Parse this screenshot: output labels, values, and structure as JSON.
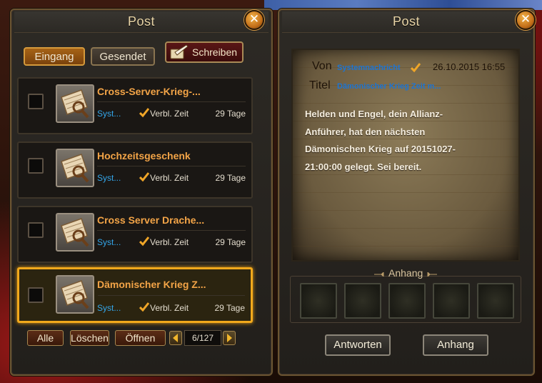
{
  "left_panel": {
    "title": "Post",
    "tabs": [
      {
        "label": "Eingang",
        "active": true
      },
      {
        "label": "Gesendet",
        "active": false
      }
    ],
    "write_button": "Schreiben",
    "mails": [
      {
        "subject": "Cross-Server-Krieg-...",
        "sender": "Syst...",
        "time_label": "Verbl. Zeit",
        "days": "29 Tage",
        "selected": false
      },
      {
        "subject": "Hochzeitsgeschenk",
        "sender": "Syst...",
        "time_label": "Verbl. Zeit",
        "days": "29 Tage",
        "selected": false
      },
      {
        "subject": "Cross Server Drache...",
        "sender": "Syst...",
        "time_label": "Verbl. Zeit",
        "days": "29 Tage",
        "selected": false
      },
      {
        "subject": "Dämonischer Krieg Z...",
        "sender": "Syst...",
        "time_label": "Verbl. Zeit",
        "days": "29 Tage",
        "selected": true
      }
    ],
    "footer": {
      "all_button": "Alle",
      "delete_button": "Löschen",
      "open_button": "Öffnen",
      "page": "6/127"
    }
  },
  "right_panel": {
    "title": "Post",
    "from_label": "Von",
    "from_value": "Systemnachricht",
    "date": "26.10.2015 16:55",
    "title_label": "Titel",
    "title_value": "Dämonischer Krieg Zeit m...",
    "body_lines": [
      "Helden und Engel, dein Allianz-",
      "Anführer, hat den nächsten",
      "Dämonischen Krieg auf 20151027-",
      "21:00:00 gelegt. Sei bereit."
    ],
    "attachment_title": "Anhang",
    "attachment_slots": 5,
    "reply_button": "Antworten",
    "attachment_button": "Anhang"
  },
  "colors": {
    "accent_orange": "#f3a447",
    "sender_blue": "#34a6ea",
    "selected_border": "#f2a91c"
  },
  "icons": [
    "close-icon",
    "quill-icon",
    "mail-scroll-icon",
    "check-icon",
    "arrow-left-icon",
    "arrow-right-icon"
  ]
}
